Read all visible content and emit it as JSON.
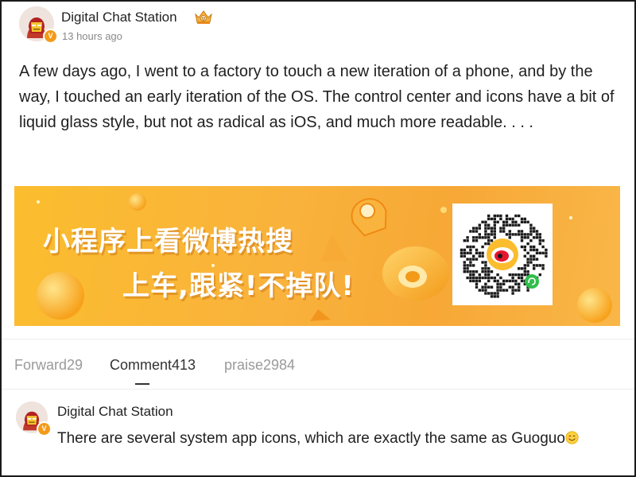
{
  "post": {
    "author": "Digital Chat Station",
    "time": "13 hours ago",
    "body": "A few days ago, I went to a factory to touch a new iteration of a phone, and by the way, I touched an early iteration of the OS. The control center and icons have a bit of liquid glass style, but not as radical as iOS, and much more readable. . . ."
  },
  "banner": {
    "line1": "小程序上看微博热搜",
    "line2": "上车,跟紧!不掉队!"
  },
  "tabs": {
    "forward": "Forward29",
    "comment": "Comment413",
    "praise": "praise2984",
    "active": "comment"
  },
  "comment": {
    "author": "Digital Chat Station",
    "text": "There are several system app icons, which are exactly the same as Guoguo"
  },
  "icons": {
    "verified_badge": "verified-v-icon",
    "crown": "crown-badge-icon",
    "qr": "mini-program-qr-code",
    "emoji": "smile-emoji-icon"
  },
  "colors": {
    "banner_orange": "#fbbd2e",
    "verified_orange": "#f39a1a",
    "muted_text": "#8a8a8a"
  }
}
